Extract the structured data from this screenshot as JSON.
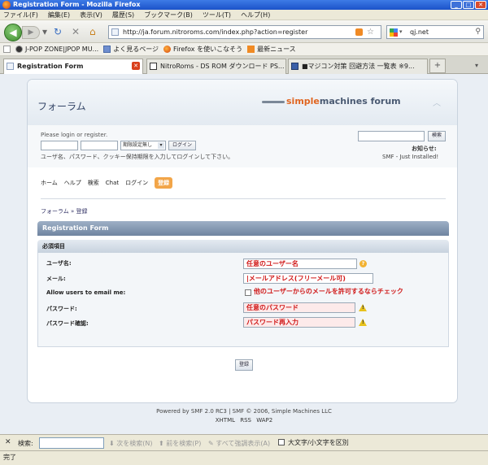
{
  "window": {
    "title": "Registration Form - Mozilla Firefox"
  },
  "menubar": [
    "ファイル(F)",
    "編集(E)",
    "表示(V)",
    "履歴(S)",
    "ブックマーク(B)",
    "ツール(T)",
    "ヘルプ(H)"
  ],
  "navbar": {
    "url": "http://ja.forum.nitroroms.com/index.php?action=register",
    "search_value": "qj.net"
  },
  "bookmarks": [
    "J-POP ZONE|JPOP MU...",
    "よく見るページ",
    "Firefox を使いこなそう",
    "最新ニュース"
  ],
  "tabs": [
    {
      "label": "Registration Form",
      "active": true
    },
    {
      "label": "NitroRoms - DS ROM ダウンロード PS...",
      "active": false
    },
    {
      "label": "■マジコン対策 回避方法 一覧表 ※9...",
      "active": false
    }
  ],
  "forum": {
    "title": "フォーラム",
    "logo_simple": "simple",
    "logo_rest": "machines forum",
    "login_prompt": "Please login or register.",
    "session_select": "期限設定無し",
    "login_button": "ログイン",
    "login_help": "ユーザ名、パスワード、クッキー保持期限を入力してログインして下さい。",
    "search_button": "検索",
    "news_label": "お知らせ:",
    "news_text": "SMF - Just Installed!",
    "menu": [
      "ホーム",
      "ヘルプ",
      "検索",
      "Chat",
      "ログイン",
      "登録"
    ],
    "breadcrumb": "フォーラム » 登録",
    "category_title": "Registration Form",
    "section_title": "必須項目",
    "fields": [
      {
        "label": "ユーザ名:",
        "value": "任意のユーザー名"
      },
      {
        "label": "メール:",
        "value": "|メールアドレス(フリーメール可)"
      },
      {
        "label": "Allow users to email me:",
        "value": "他のユーザーからのメールを許可するならチェック"
      },
      {
        "label": "パスワード:",
        "value": "任意のパスワード"
      },
      {
        "label": "パスワード確認:",
        "value": "パスワード再入力"
      }
    ],
    "register_button": "登録",
    "footer": "Powered by SMF 2.0 RC3 | SMF © 2006, Simple Machines LLC",
    "footer_links": "XHTML RSS WAP2"
  },
  "findbar": {
    "label": "検索:",
    "next": "次を検索(N)",
    "prev": "前を検索(P)",
    "highlight": "すべて強調表示(A)",
    "match_case": "大文字/小文字を区別"
  },
  "status": "完了",
  "colors": {
    "accent_orange": "#f2a548",
    "annotation_red": "#d01818",
    "cat_bar": "#7f94b0"
  }
}
